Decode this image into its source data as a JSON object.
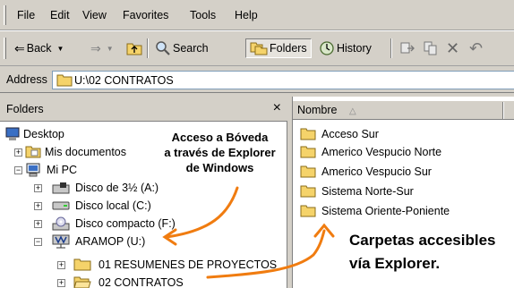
{
  "menu": [
    "File",
    "Edit",
    "View",
    "Favorites",
    "Tools",
    "Help"
  ],
  "toolbar": {
    "back": "Back",
    "search": "Search",
    "folders": "Folders",
    "history": "History"
  },
  "address": {
    "label": "Address",
    "value": "U:\\02 CONTRATOS"
  },
  "folders_pane": {
    "title": "Folders",
    "close": "×",
    "tree": [
      {
        "label": "Desktop"
      },
      {
        "label": "Mis documentos"
      },
      {
        "label": "Mi PC"
      },
      {
        "label": "Disco de 3½ (A:)"
      },
      {
        "label": "Disco local (C:)"
      },
      {
        "label": "Disco compacto (F:)"
      },
      {
        "label": "ARAMOP (U:)"
      },
      {
        "label": "01 RESUMENES DE PROYECTOS"
      },
      {
        "label": "02 CONTRATOS"
      }
    ]
  },
  "contents_pane": {
    "column_name": "Nombre",
    "sort_indicator": "△",
    "items": [
      "Acceso Sur",
      "Americo Vespucio Norte",
      "Americo Vespucio Sur",
      "Sistema Norte-Sur",
      "Sistema Oriente-Poniente"
    ]
  },
  "annotations": {
    "boveda_line1": "Acceso a Bóveda",
    "boveda_line2": "a través de Explorer",
    "boveda_line3": "de Windows",
    "carpetas_line1": "Carpetas accesibles",
    "carpetas_line2": "vía Explorer."
  },
  "colors": {
    "arrow": "#f07c10",
    "folder": "#f5d36a"
  }
}
